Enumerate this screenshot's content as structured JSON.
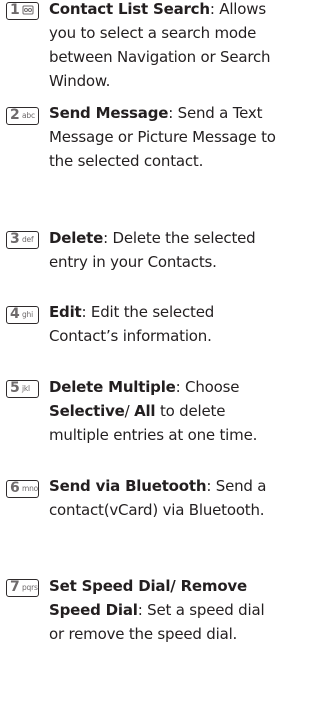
{
  "entries": [
    {
      "key_digit": "1",
      "key_letters": "",
      "key_symbol": "voicemail",
      "term": "Contact List Search",
      "text": ": Allows you to select a search mode between Navigation or Search Window."
    },
    {
      "key_digit": "2",
      "key_letters": "abc",
      "term": "Send Message",
      "text": ": Send a Text Message or Picture Message to the selected contact."
    },
    {
      "key_digit": "3",
      "key_letters": "def",
      "term": "Delete",
      "text": ": Delete the selected entry in your Contacts."
    },
    {
      "key_digit": "4",
      "key_letters": "ghi",
      "term": "Edit",
      "text": ": Edit the selected Contact’s information."
    },
    {
      "key_digit": "5",
      "key_letters": "jkl",
      "term": "Delete Multiple",
      "text_a": ": Choose ",
      "term_b": "Selective",
      "text_b": "/ ",
      "term_c": "All",
      "text_c": " to delete multiple entries at one time."
    },
    {
      "key_digit": "6",
      "key_letters": "mno",
      "term": "Send via Bluetooth",
      "text": ": Send a contact(vCard) via Bluetooth."
    },
    {
      "key_digit": "7",
      "key_letters": "pqrs",
      "term": "Set Speed Dial/ Remove Speed Dial",
      "text": ": Set a speed dial or remove the speed dial."
    }
  ],
  "colors": {
    "text": "#231f20",
    "key_border": "#2f2b2c",
    "key_glyph": "#6e6a6b"
  }
}
